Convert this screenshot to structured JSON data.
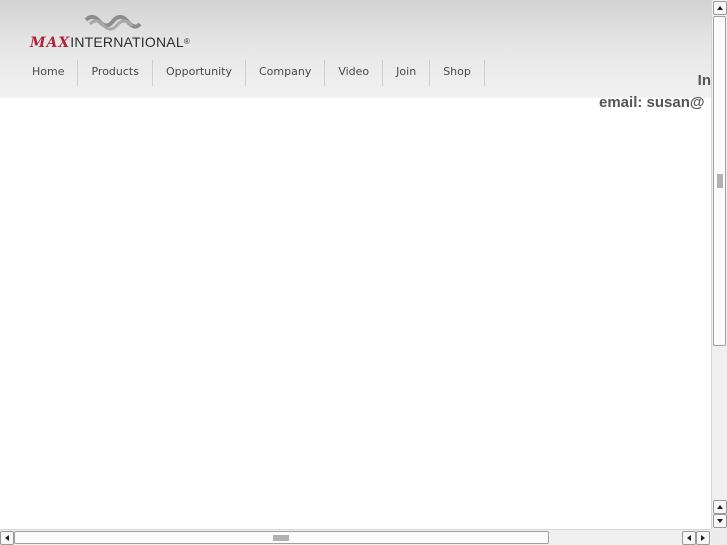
{
  "brand": {
    "logo_mark": "MAX",
    "logo_name": "INTERNATIONAL",
    "logo_registered": "®",
    "accent_color": "#b0243a"
  },
  "nav": {
    "items": [
      {
        "label": "Home"
      },
      {
        "label": "Products"
      },
      {
        "label": "Opportunity"
      },
      {
        "label": "Company"
      },
      {
        "label": "Video"
      },
      {
        "label": "Join"
      },
      {
        "label": "Shop"
      }
    ]
  },
  "contact": {
    "line1": "In",
    "line2": "email: susan@"
  },
  "scrollbars": {
    "vertical_icon_up": "arrow-up-icon",
    "vertical_icon_down": "arrow-down-icon",
    "horizontal_icon_left": "arrow-left-icon",
    "horizontal_icon_right": "arrow-right-icon"
  }
}
